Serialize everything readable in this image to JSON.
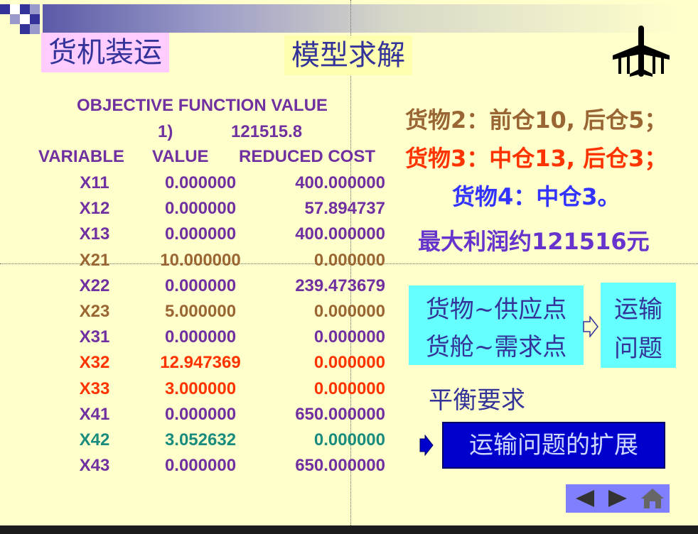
{
  "slide": {
    "title_left": "货机装运",
    "title_right": "模型求解"
  },
  "lp_output": {
    "header": "OBJECTIVE FUNCTION VALUE",
    "objective_row_label": "1)",
    "objective_value": "121515.8",
    "col_variable": "VARIABLE",
    "col_value": "VALUE",
    "col_reduced_cost": "REDUCED COST",
    "rows": [
      {
        "name": "X11",
        "value": "0.000000",
        "reduced_cost": "400.000000",
        "color": "#7030a0"
      },
      {
        "name": "X12",
        "value": "0.000000",
        "reduced_cost": "57.894737",
        "color": "#7030a0"
      },
      {
        "name": "X13",
        "value": "0.000000",
        "reduced_cost": "400.000000",
        "color": "#7030a0"
      },
      {
        "name": "X21",
        "value": "10.000000",
        "reduced_cost": "0.000000",
        "color": "#996633"
      },
      {
        "name": "X22",
        "value": "0.000000",
        "reduced_cost": "239.473679",
        "color": "#7030a0"
      },
      {
        "name": "X23",
        "value": "5.000000",
        "reduced_cost": "0.000000",
        "color": "#996633"
      },
      {
        "name": "X31",
        "value": "0.000000",
        "reduced_cost": "0.000000",
        "color": "#7030a0"
      },
      {
        "name": "X32",
        "value": "12.947369",
        "reduced_cost": "0.000000",
        "color": "#ff3300"
      },
      {
        "name": "X33",
        "value": "3.000000",
        "reduced_cost": "0.000000",
        "color": "#ff3300"
      },
      {
        "name": "X41",
        "value": "0.000000",
        "reduced_cost": "650.000000",
        "color": "#7030a0"
      },
      {
        "name": "X42",
        "value": "3.052632",
        "reduced_cost": "0.000000",
        "color": "#198c7e"
      },
      {
        "name": "X43",
        "value": "0.000000",
        "reduced_cost": "650.000000",
        "color": "#7030a0"
      }
    ]
  },
  "results": {
    "cargo2": "货物2：前仓10, 后仓5；",
    "cargo3": "货物3：中仓13, 后仓3；",
    "cargo4": "货物4：中仓3。",
    "max_profit": "最大利润约121516元",
    "colors": {
      "cargo2": "#996633",
      "cargo3": "#ff3300",
      "cargo4": "#3333ff",
      "profit": "#6633cc"
    }
  },
  "concept": {
    "supply_line": "货物~供应点",
    "demand_line": "货舱~需求点",
    "transport_line1": "运输",
    "transport_line2": "问题",
    "balance": "平衡要求",
    "extension_button": "运输问题的扩展"
  },
  "nav": {
    "prev_icon": "triangle-left-icon",
    "next_icon": "triangle-right-icon",
    "home_icon": "house-icon"
  }
}
